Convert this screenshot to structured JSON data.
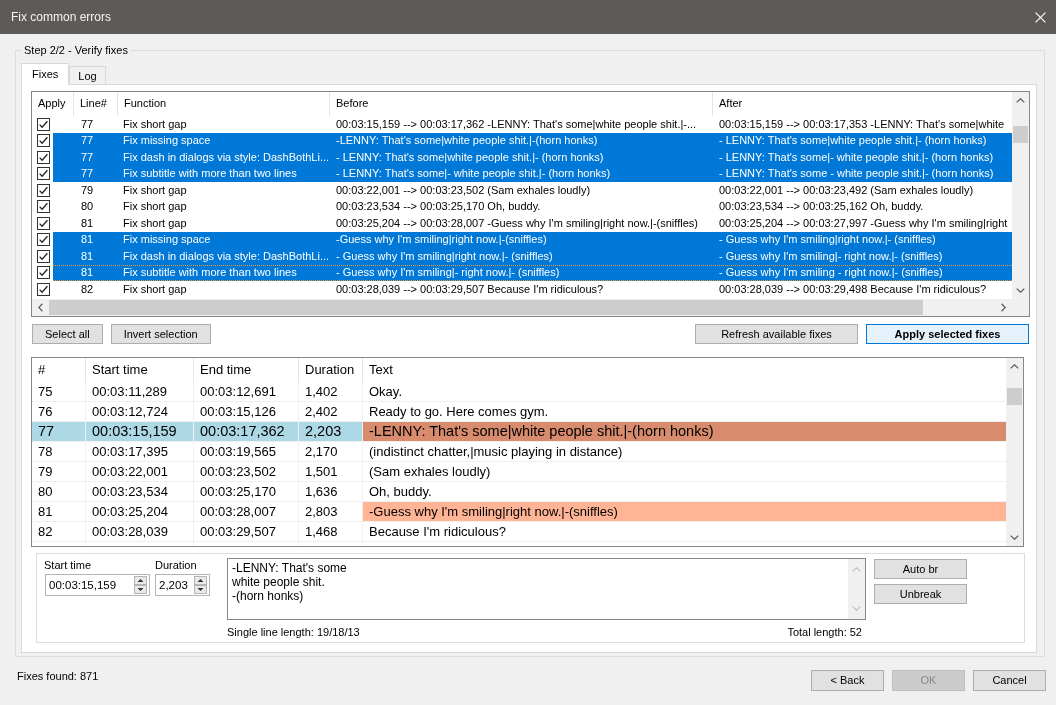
{
  "window": {
    "title": "Fix common errors"
  },
  "step_group": {
    "title": "Step 2/2 - Verify fixes"
  },
  "tabs": [
    {
      "label": "Fixes",
      "selected": true
    },
    {
      "label": "Log",
      "selected": false
    }
  ],
  "fixes": {
    "columns": [
      "Apply",
      "Line#",
      "Function",
      "Before",
      "After"
    ],
    "rows": [
      {
        "apply": true,
        "line": "77",
        "function": "Fix short gap",
        "before": "00:03:15,159 --> 00:03:17,362 -LENNY: That's some|white people shit.|-...",
        "after": "00:03:15,159 --> 00:03:17,353 -LENNY: That's some|white",
        "selected": false,
        "focused": false
      },
      {
        "apply": true,
        "line": "77",
        "function": "Fix missing space",
        "before": "-LENNY: That's some|white people shit.|-(horn honks)",
        "after": "- LENNY: That's some|white people shit.|- (horn honks)",
        "selected": true,
        "focused": false
      },
      {
        "apply": true,
        "line": "77",
        "function": "Fix dash in dialogs via style: DashBothLi...",
        "before": "- LENNY: That's some|white people shit.|- (horn honks)",
        "after": "- LENNY: That's some|- white people shit.|- (horn honks)",
        "selected": true,
        "focused": false
      },
      {
        "apply": true,
        "line": "77",
        "function": "Fix subtitle with more than two lines",
        "before": "- LENNY: That's some|- white people shit.|- (horn honks)",
        "after": "- LENNY: That's some - white people shit.|- (horn honks)",
        "selected": true,
        "focused": false
      },
      {
        "apply": true,
        "line": "79",
        "function": "Fix short gap",
        "before": "00:03:22,001 --> 00:03:23,502 (Sam exhales loudly)",
        "after": "00:03:22,001 --> 00:03:23,492 (Sam exhales loudly)",
        "selected": false,
        "focused": false
      },
      {
        "apply": true,
        "line": "80",
        "function": "Fix short gap",
        "before": "00:03:23,534 --> 00:03:25,170 Oh, buddy.",
        "after": "00:03:23,534 --> 00:03:25,162 Oh, buddy.",
        "selected": false,
        "focused": false
      },
      {
        "apply": true,
        "line": "81",
        "function": "Fix short gap",
        "before": "00:03:25,204 --> 00:03:28,007 -Guess why I'm smiling|right now.|-(sniffles)",
        "after": "00:03:25,204 --> 00:03:27,997 -Guess why I'm smiling|right",
        "selected": false,
        "focused": false
      },
      {
        "apply": true,
        "line": "81",
        "function": "Fix missing space",
        "before": "-Guess why I'm smiling|right now.|-(sniffles)",
        "after": "- Guess why I'm smiling|right now.|- (sniffles)",
        "selected": true,
        "focused": false
      },
      {
        "apply": true,
        "line": "81",
        "function": "Fix dash in dialogs via style: DashBothLi...",
        "before": "- Guess why I'm smiling|right now.|- (sniffles)",
        "after": "- Guess why I'm smiling|- right now.|- (sniffles)",
        "selected": true,
        "focused": false
      },
      {
        "apply": true,
        "line": "81",
        "function": "Fix subtitle with more than two lines",
        "before": "- Guess why I'm smiling|- right now.|- (sniffles)",
        "after": "- Guess why I'm smiling - right now.|- (sniffles)",
        "selected": true,
        "focused": true
      },
      {
        "apply": true,
        "line": "82",
        "function": "Fix short gap",
        "before": "00:03:28,039 --> 00:03:29,507 Because I'm ridiculous?",
        "after": "00:03:28,039 --> 00:03:29,498 Because I'm ridiculous?",
        "selected": false,
        "focused": false
      }
    ]
  },
  "selection_buttons": [
    {
      "label": "Select all"
    },
    {
      "label": "Invert selection"
    }
  ],
  "fix_buttons": [
    {
      "label": "Refresh available fixes",
      "default": false
    },
    {
      "label": "Apply selected fixes",
      "default": true
    }
  ],
  "subtitles": {
    "columns": [
      "#",
      "Start time",
      "End time",
      "Duration",
      "Text"
    ],
    "rows": [
      {
        "number": "75",
        "start": "00:03:11,289",
        "end": "00:03:12,691",
        "duration": "1,402",
        "text": "Okay.",
        "selected": false
      },
      {
        "number": "76",
        "start": "00:03:12,724",
        "end": "00:03:15,126",
        "duration": "2,402",
        "text": "Ready to go. Here comes gym.",
        "selected": false
      },
      {
        "number": "77",
        "start": "00:03:15,159",
        "end": "00:03:17,362",
        "duration": "2,203",
        "text": "-LENNY: That's some|white people shit.|-(horn honks)",
        "selected": true,
        "color": "#d88b6d"
      },
      {
        "number": "78",
        "start": "00:03:17,395",
        "end": "00:03:19,565",
        "duration": "2,170",
        "text": "(indistinct chatter,|music playing in distance)",
        "selected": false
      },
      {
        "number": "79",
        "start": "00:03:22,001",
        "end": "00:03:23,502",
        "duration": "1,501",
        "text": "(Sam exhales loudly)",
        "selected": false
      },
      {
        "number": "80",
        "start": "00:03:23,534",
        "end": "00:03:25,170",
        "duration": "1,636",
        "text": "Oh, buddy.",
        "selected": false
      },
      {
        "number": "81",
        "start": "00:03:25,204",
        "end": "00:03:28,007",
        "duration": "2,803",
        "text": "-Guess why I'm smiling|right now.|-(sniffles)",
        "selected": false,
        "color": "#ffb496"
      },
      {
        "number": "82",
        "start": "00:03:28,039",
        "end": "00:03:29,507",
        "duration": "1,468",
        "text": "Because I'm ridiculous?",
        "selected": false
      }
    ]
  },
  "editor": {
    "start_time": {
      "label": "Start time",
      "value": "00:03:15,159"
    },
    "duration": {
      "label": "Duration",
      "value": "2,203"
    },
    "text": "-LENNY: That's some\nwhite people shit.\n-(horn honks)",
    "single_line_length": "Single line length: 19/18/13",
    "total_length": "Total length: 52",
    "buttons": [
      {
        "label": "Auto br"
      },
      {
        "label": "Unbreak"
      }
    ]
  },
  "status_bar": {
    "text": "Fixes found: 871"
  },
  "dialog_buttons": [
    {
      "label": "< Back",
      "disabled": false
    },
    {
      "label": "OK",
      "disabled": true
    },
    {
      "label": "Cancel",
      "disabled": false
    }
  ]
}
